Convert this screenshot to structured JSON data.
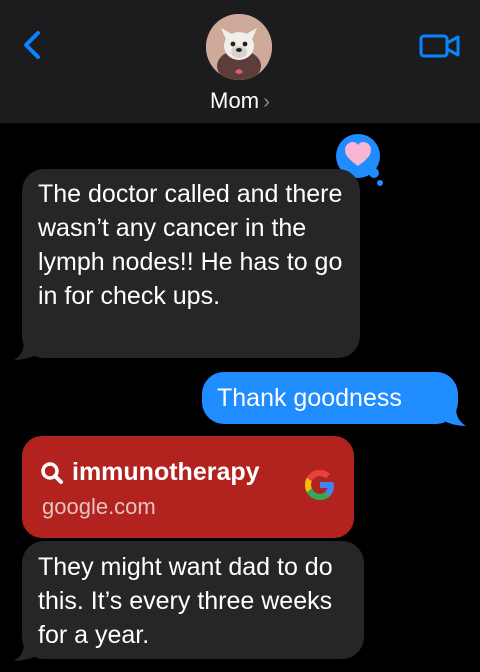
{
  "header": {
    "contact_name": "Mom",
    "chevron": "›"
  },
  "icons": {
    "back": "chevron-left-icon",
    "video": "video-camera-icon",
    "reaction": "heart-reaction-icon",
    "search": "search-icon",
    "google": "google-logo-icon"
  },
  "colors": {
    "header_bg": "#1c1c1e",
    "incoming_bubble": "#262629",
    "outgoing_bubble": "#1f8cff",
    "link_card": "#b2231f",
    "accent": "#0a84ff"
  },
  "messages": [
    {
      "direction": "incoming",
      "text": "The doctor called and there wasn’t any cancer in the lymph nodes!! He has to go in for check ups."
    },
    {
      "direction": "outgoing",
      "text": "Thank goodness"
    },
    {
      "direction": "incoming",
      "type": "link",
      "title": "immunotherapy",
      "domain": "google.com"
    },
    {
      "direction": "incoming",
      "text": "They might want dad to do this. It’s every three weeks for a year."
    }
  ]
}
